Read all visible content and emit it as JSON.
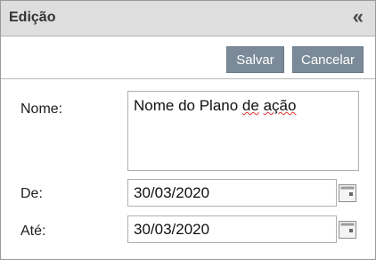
{
  "panel": {
    "title": "Edição",
    "collapse_glyph": "«",
    "collapse_icon": "double-chevron-left-icon"
  },
  "toolbar": {
    "save_label": "Salvar",
    "cancel_label": "Cancelar"
  },
  "form": {
    "name_label": "Nome:",
    "name_value_prefix": "Nome do Plano ",
    "name_value_de": "de",
    "name_value_space": " ",
    "name_value_acao": "ação",
    "from_label": "De:",
    "from_value": "30/03/2020",
    "to_label": "Até:",
    "to_value": "30/03/2020",
    "calendar_icon": "calendar-icon"
  },
  "colors": {
    "titlebar": "#dedede",
    "button": "#7a8a98",
    "spellcheck": "#e03030"
  }
}
